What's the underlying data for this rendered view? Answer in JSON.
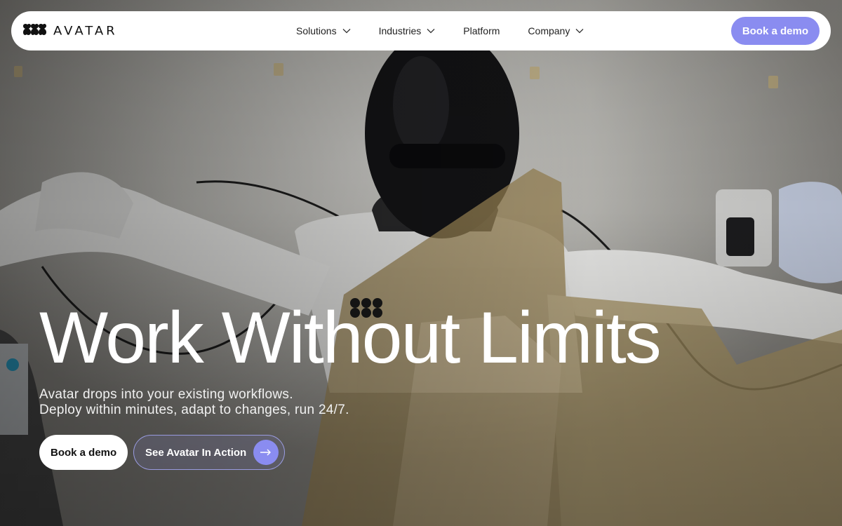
{
  "brand": {
    "name": "AVATAR",
    "logo_icon": "avatar-logo-icon"
  },
  "nav": {
    "items": [
      {
        "label": "Solutions",
        "has_dropdown": true
      },
      {
        "label": "Industries",
        "has_dropdown": true
      },
      {
        "label": "Platform",
        "has_dropdown": false
      },
      {
        "label": "Company",
        "has_dropdown": true
      }
    ],
    "cta_label": "Book a demo"
  },
  "hero": {
    "title": "Work Without Limits",
    "subtitle_line1": "Avatar drops into your existing workflows.",
    "subtitle_line2": "Deploy within minutes, adapt to changes, run 24/7.",
    "primary_button": "Book a demo",
    "secondary_button": "See Avatar In Action",
    "secondary_icon": "arrow-right-icon"
  },
  "colors": {
    "accent": "#8a8cf0",
    "navbar_bg": "#ffffff",
    "text_dark": "#1c1c1c",
    "text_light": "#ffffff"
  }
}
